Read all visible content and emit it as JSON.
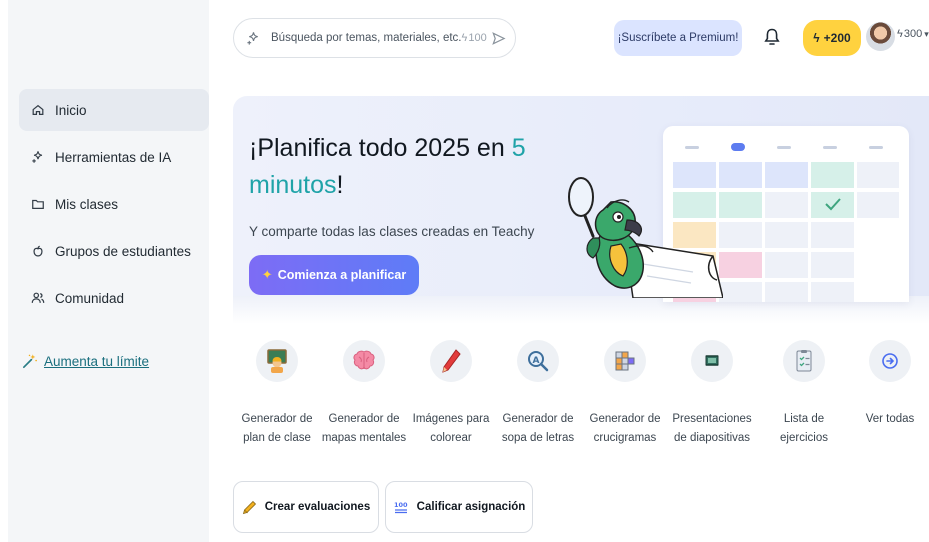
{
  "sidebar": {
    "items": [
      {
        "label": "Inicio",
        "icon": "home-icon",
        "active": true
      },
      {
        "label": "Herramientas de IA",
        "icon": "sparkle-icon"
      },
      {
        "label": "Mis clases",
        "icon": "folder-icon"
      },
      {
        "label": "Grupos de estudiantes",
        "icon": "apple-icon"
      },
      {
        "label": "Comunidad",
        "icon": "people-icon"
      }
    ],
    "upgrade_label": "Aumenta tu límite"
  },
  "topbar": {
    "search_placeholder": "Búsqueda por temas, materiales, etc.",
    "search_cost": "100",
    "premium_label": "¡Suscríbete a Premium!",
    "bonus_credits": "+200",
    "user_credits": "300"
  },
  "hero": {
    "title_part1": "¡Planifica todo 2025 en ",
    "title_highlight": "5 minutos",
    "title_end": "!",
    "subtitle": "Y comparte todas las clases creadas en Teachy",
    "cta_label": "Comienza a planificar"
  },
  "tools": [
    {
      "label": "Generador de plan de clase",
      "icon": "teacher-board-icon"
    },
    {
      "label": "Generador de mapas mentales",
      "icon": "brain-icon"
    },
    {
      "label": "Imágenes para colorear",
      "icon": "crayon-icon"
    },
    {
      "label": "Generador de sopa de letras",
      "icon": "magnifier-letter-icon"
    },
    {
      "label": "Generador de crucigramas",
      "icon": "crossword-icon"
    },
    {
      "label": "Presentaciones de diapositivas",
      "icon": "slides-icon"
    },
    {
      "label": "Lista de ejercicios",
      "icon": "checklist-icon"
    },
    {
      "label": "Ver todas",
      "icon": "arrow-right-circle-icon"
    }
  ],
  "actions": {
    "create_evaluations": "Crear evaluaciones",
    "grade_assignment": "Calificar asignación"
  },
  "colors": {
    "accent_teal": "#1fa3a8",
    "cta_gradient_start": "#7d6cf5",
    "cta_gradient_end": "#5e7cf7",
    "credits_yellow": "#ffd23f",
    "premium_bg": "#dbe4ff"
  }
}
